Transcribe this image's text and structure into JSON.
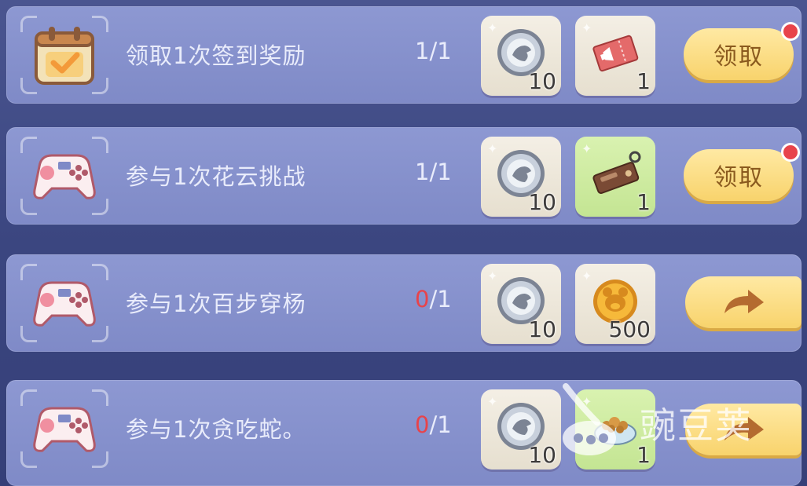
{
  "tasks": [
    {
      "label": "领取1次签到奖励",
      "icon": "calendar-check-icon",
      "progress_current": "1",
      "progress_sep": "/",
      "progress_total": "1",
      "current_color": "#e9ecfb",
      "rewards": [
        {
          "icon": "silver-coin-icon",
          "count": "10",
          "bg": "beige"
        },
        {
          "icon": "ticket-icon",
          "count": "1",
          "bg": "beige"
        }
      ],
      "action": "领取",
      "action_type": "claim",
      "has_dot": true
    },
    {
      "label": "参与1次花云挑战",
      "icon": "gamepad-icon",
      "progress_current": "1",
      "progress_sep": "/",
      "progress_total": "1",
      "current_color": "#e9ecfb",
      "rewards": [
        {
          "icon": "silver-coin-icon",
          "count": "10",
          "bg": "beige"
        },
        {
          "icon": "name-tag-board-icon",
          "count": "1",
          "bg": "green"
        }
      ],
      "action": "领取",
      "action_type": "claim",
      "has_dot": true
    },
    {
      "label": "参与1次百步穿杨",
      "icon": "gamepad-icon",
      "progress_current": "0",
      "progress_sep": "/",
      "progress_total": "1",
      "current_color": "#e8434a",
      "rewards": [
        {
          "icon": "silver-coin-icon",
          "count": "10",
          "bg": "beige"
        },
        {
          "icon": "gold-bear-coin-icon",
          "count": "500",
          "bg": "beige"
        }
      ],
      "action": "",
      "action_type": "go",
      "has_dot": false
    },
    {
      "label": "参与1次贪吃蛇。",
      "icon": "gamepad-icon",
      "progress_current": "0",
      "progress_sep": "/",
      "progress_total": "1",
      "current_color": "#e8434a",
      "rewards": [
        {
          "icon": "silver-coin-icon",
          "count": "10",
          "bg": "beige"
        },
        {
          "icon": "food-bowl-icon",
          "count": "1",
          "bg": "green"
        }
      ],
      "action": "",
      "action_type": "go",
      "has_dot": false
    }
  ],
  "watermark": {
    "text": "豌豆荚",
    "icon": "pea-pod-logo-icon"
  },
  "colors": {
    "panel": "#8892cc",
    "button": "#f8d36c",
    "button_text": "#8a5a1e",
    "red_dot": "#e8434a"
  }
}
